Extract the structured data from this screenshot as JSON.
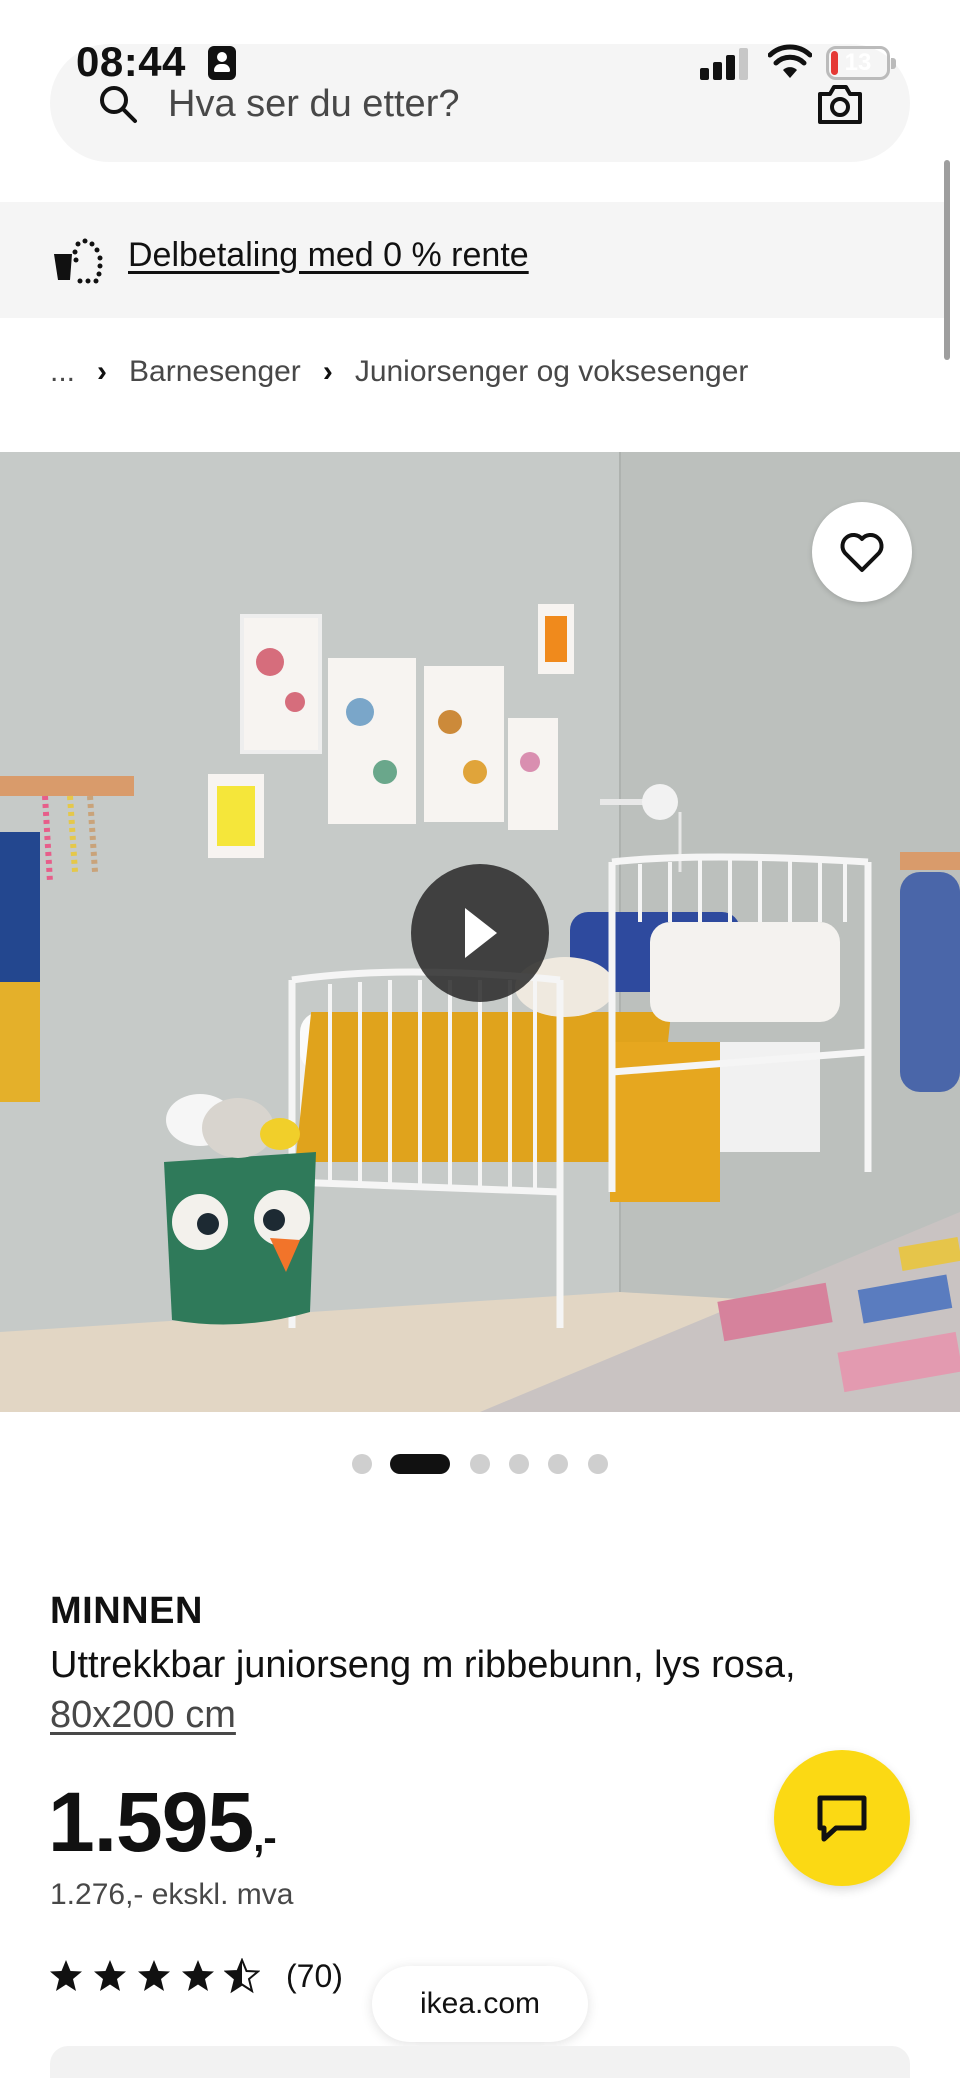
{
  "status_bar": {
    "time": "08:44",
    "battery_level": "13",
    "battery_color": "#e53935"
  },
  "search": {
    "placeholder": "Hva ser du etter?",
    "search_icon": "search-icon",
    "camera_icon": "camera-icon"
  },
  "promo": {
    "icon": "installment-basket-icon",
    "link_text": "Delbetaling med 0 % rente"
  },
  "breadcrumb": {
    "items": [
      "...",
      "Barnesenger",
      "Juniorsenger og voksesenger"
    ]
  },
  "gallery": {
    "favorite_icon": "heart-icon",
    "play_icon": "play-icon",
    "dot_count": 6,
    "active_index": 1
  },
  "product": {
    "brand": "MINNEN",
    "description": "Uttrekkbar juniorseng m ribbebunn, lys rosa,",
    "size": "80x200 cm",
    "price": "1.595",
    "price_suffix": ",-",
    "price_ex_vat": "1.276,- ekskl. mva",
    "rating_value": 4.5,
    "rating_max": 5,
    "review_count": "(70)"
  },
  "chat": {
    "icon": "chat-icon",
    "color": "#fbd914"
  },
  "browser": {
    "url": "ikea.com"
  }
}
